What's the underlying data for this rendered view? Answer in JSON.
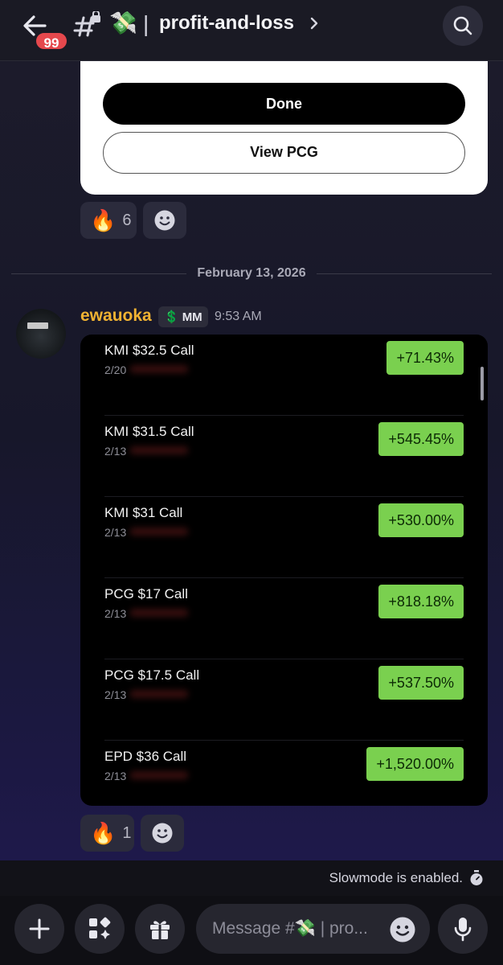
{
  "header": {
    "unread_count": "99",
    "channel_emoji": "💸",
    "separator": "|",
    "channel_name": "profit-and-loss"
  },
  "top_card": {
    "done_label": "Done",
    "view_label": "View PCG"
  },
  "reactions_top": {
    "emoji": "🔥",
    "count": "6"
  },
  "date_divider": "February 13, 2026",
  "message": {
    "author": "ewauoka",
    "role_emoji": "💲",
    "role_label": "MM",
    "time": "9:53 AM"
  },
  "trades": [
    {
      "name": "KMI $32.5 Call",
      "date": "2/20",
      "change": "+71.43%"
    },
    {
      "name": "KMI $31.5 Call",
      "date": "2/13",
      "change": "+545.45%"
    },
    {
      "name": "KMI $31 Call",
      "date": "2/13",
      "change": "+530.00%"
    },
    {
      "name": "PCG $17 Call",
      "date": "2/13",
      "change": "+818.18%"
    },
    {
      "name": "PCG $17.5 Call",
      "date": "2/13",
      "change": "+537.50%"
    },
    {
      "name": "EPD $36 Call",
      "date": "2/13",
      "change": "+1,520.00%"
    }
  ],
  "reactions_bottom": {
    "emoji": "🔥",
    "count": "1"
  },
  "slowmode_text": "Slowmode is enabled.",
  "composer": {
    "placeholder": "Message #💸 | pro..."
  },
  "colors": {
    "gain_pill": "#7ad04f",
    "author": "#f0b232",
    "badge": "#e5484d"
  }
}
